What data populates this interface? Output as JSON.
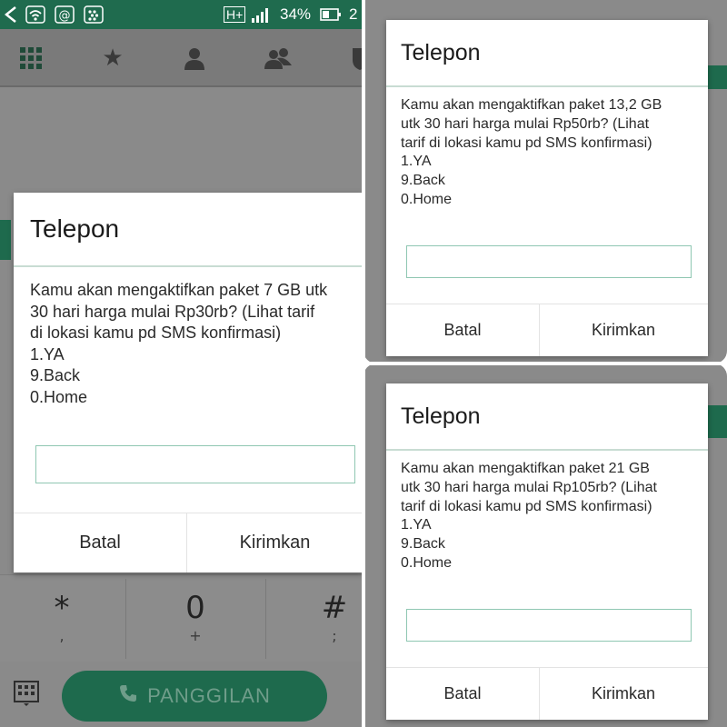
{
  "status_bar": {
    "network_label": "H+",
    "battery_percent": "34%",
    "clock_partial": "2",
    "icons": [
      "back-arrow-icon",
      "wifi-icon",
      "at-sign-icon",
      "bbm-icon",
      "signal-icon",
      "battery-icon"
    ]
  },
  "tabs": [
    {
      "icon": "dialpad-grid-icon"
    },
    {
      "icon": "star-icon"
    },
    {
      "icon": "person-icon"
    },
    {
      "icon": "group-icon"
    },
    {
      "icon": "shield-icon"
    }
  ],
  "keypad": {
    "star": {
      "main": "*",
      "sub": ","
    },
    "zero": {
      "main": "0",
      "sub": "+"
    },
    "hash": {
      "main": "#",
      "sub": ";"
    }
  },
  "call_button": {
    "label": "PANGGILAN",
    "icon": "phone-icon"
  },
  "dialogs": [
    {
      "title": "Telepon",
      "message": "Kamu akan mengaktifkan paket 7 GB utk\n30 hari harga mulai Rp30rb? (Lihat tarif\ndi lokasi kamu pd SMS konfirmasi)\n1.YA\n9.Back\n0.Home",
      "input_value": "",
      "cancel_label": "Batal",
      "send_label": "Kirimkan"
    },
    {
      "title": "Telepon",
      "message": "Kamu akan mengaktifkan paket 13,2 GB\nutk 30 hari harga mulai Rp50rb? (Lihat\ntarif di lokasi kamu pd SMS konfirmasi)\n1.YA\n9.Back\n0.Home",
      "input_value": "",
      "cancel_label": "Batal",
      "send_label": "Kirimkan"
    },
    {
      "title": "Telepon",
      "message": "Kamu akan mengaktifkan paket 21 GB\nutk 30 hari harga mulai Rp105rb? (Lihat\ntarif di lokasi kamu pd SMS konfirmasi)\n1.YA\n9.Back\n0.Home",
      "input_value": "",
      "cancel_label": "Batal",
      "send_label": "Kirimkan"
    }
  ],
  "colors": {
    "accent_green": "#1e6a4d",
    "dim_overlay": "#8a8a8a",
    "input_border": "#8fc7b2"
  }
}
